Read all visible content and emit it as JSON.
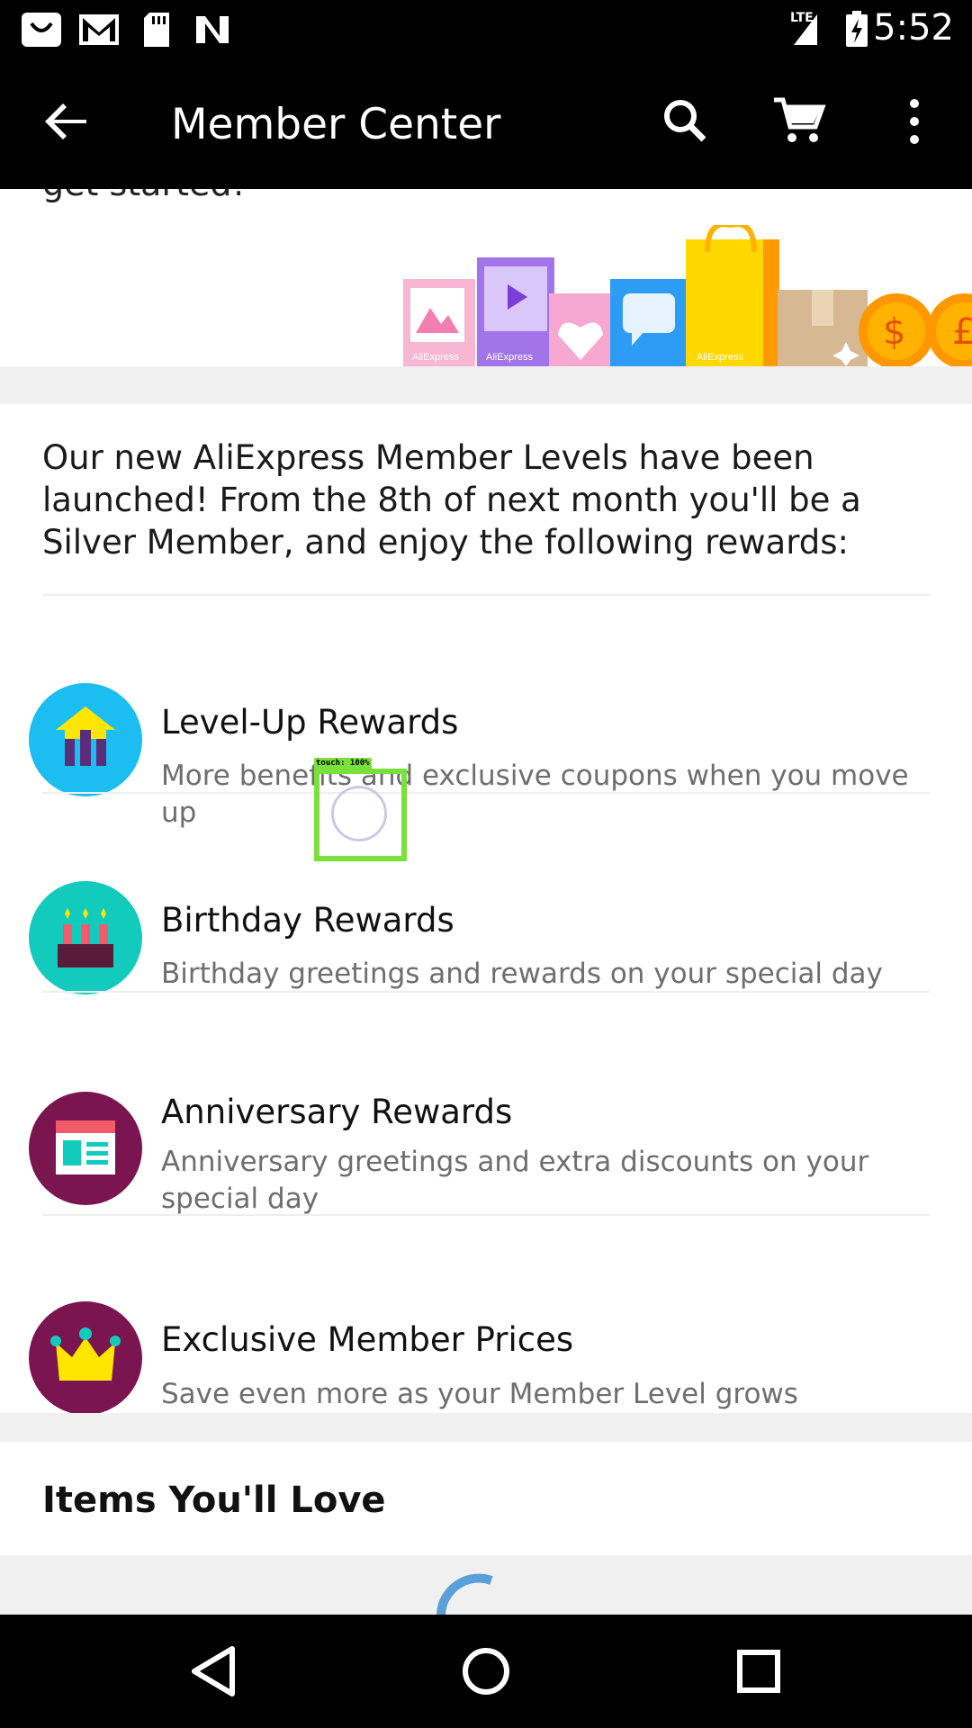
{
  "status_bar": {
    "time": "5:52",
    "network_label": "LTE",
    "icons": [
      "aliexpress-notification-icon",
      "gmail-icon",
      "sd-card-icon",
      "n-app-icon",
      "lte-signal-icon",
      "battery-charging-icon"
    ]
  },
  "app_bar": {
    "title": "Member Center",
    "icons": [
      "back-arrow-icon",
      "search-icon",
      "cart-icon",
      "overflow-menu-icon"
    ]
  },
  "banner": {
    "cut_off_text": "get started!",
    "art_labels": [
      "AliExpress",
      "AliExpress",
      "AliExpress"
    ]
  },
  "levels": {
    "intro": "Our new AliExpress Member Levels have been launched! From the 8th of next month you'll be a Silver Member, and enjoy the following rewards:",
    "rewards": [
      {
        "title": "Level-Up Rewards",
        "description": "More benefits and exclusive coupons when you move up",
        "icon": "level-up-icon",
        "color": "#1cbdf0"
      },
      {
        "title": "Birthday Rewards",
        "description": "Birthday greetings and rewards on your special day",
        "icon": "birthday-cake-icon",
        "color": "#13cbbd"
      },
      {
        "title": "Anniversary Rewards",
        "description": "Anniversary greetings and extra discounts on your special day",
        "icon": "anniversary-calendar-icon",
        "color": "#7a1550"
      },
      {
        "title": "Exclusive Member Prices",
        "description": "Save even more as your Member Level grows",
        "icon": "crown-icon",
        "color": "#7a1550"
      }
    ]
  },
  "items_section": {
    "title": "Items You'll Love"
  },
  "touch_indicator": {
    "label": "touch: 100%"
  },
  "nav_bar": {
    "icons": [
      "nav-back-icon",
      "nav-home-icon",
      "nav-recents-icon"
    ]
  }
}
